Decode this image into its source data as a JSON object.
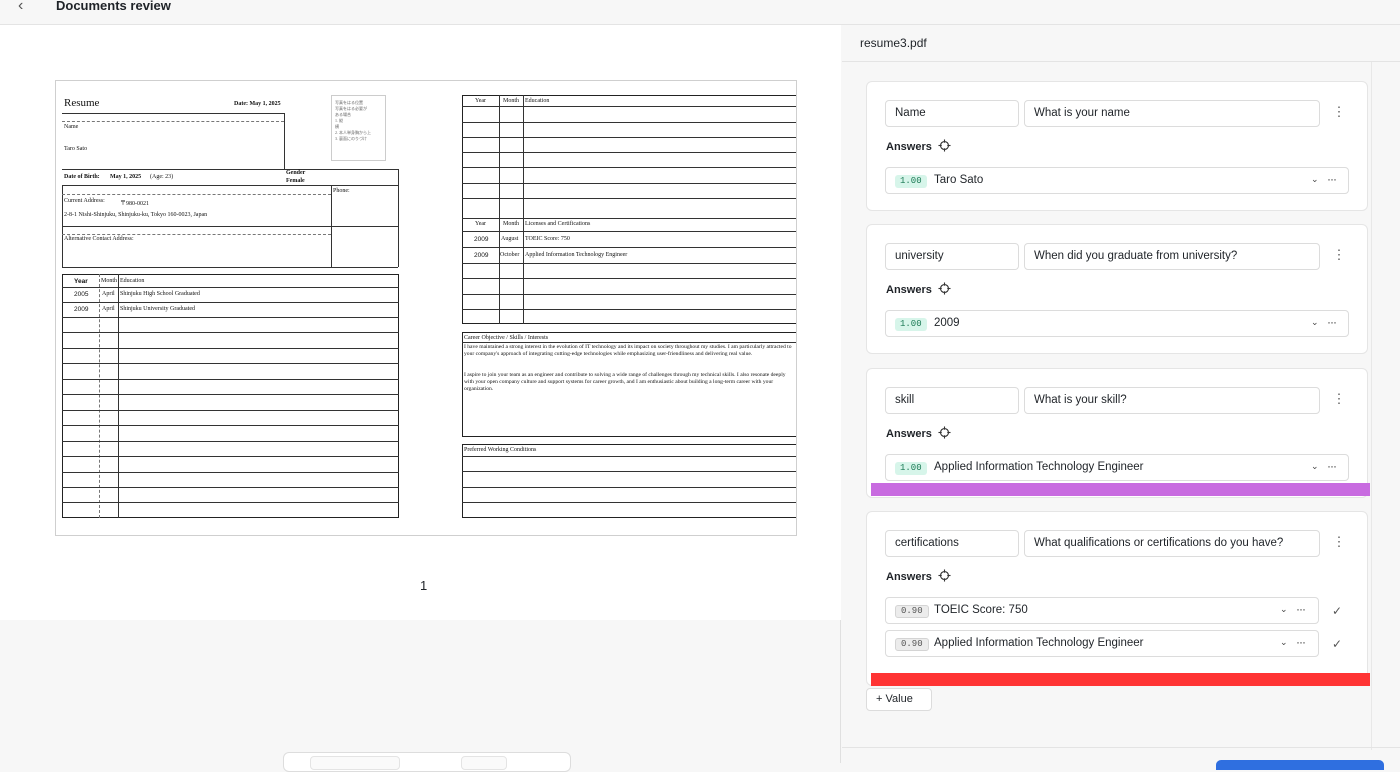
{
  "topbar": {
    "back_icon": "chevron-left-icon",
    "back_glyph": "‹",
    "title": "Documents review"
  },
  "viewer": {
    "page_number": "1",
    "document": {
      "title": "Resume",
      "date": "Date: May 1, 2025",
      "name_label": "Name",
      "name_value": "Taro Sato",
      "dob_label": "Date of Birth:",
      "dob_value": "May 1, 2025",
      "age": "(Age: 23)",
      "gender_label": "Gender",
      "gender_value": "Female",
      "phone_label": "Phone:",
      "address_label": "Current Address:",
      "postal": "〒980-0021",
      "address_value": "2-8-1 Nishi-Shinjuku, Shinjuku-ku, Tokyo 160-0023, Japan",
      "alt_address_label": "Alternative Contact Address:",
      "photo_lines": [
        "写真をはる位置",
        "",
        "写真をはる必要が",
        "ある場合",
        "1. 縦",
        "  横",
        "2. 本人単身胸から上",
        "3. 裏面にのりづけ"
      ],
      "edu_left_headers": [
        "Year",
        "Month",
        "Education"
      ],
      "edu_left_rows": [
        [
          "2005",
          "April",
          "Shinjuku High School Graduated"
        ],
        [
          "2009",
          "April",
          "Shinjuku University Graduated"
        ]
      ],
      "edu_right_headers": [
        "Year",
        "Month",
        "Education"
      ],
      "lic_headers": [
        "Year",
        "Month",
        "Licenses and Certifications"
      ],
      "lic_rows": [
        [
          "2009",
          "August",
          "TOEIC Score: 750"
        ],
        [
          "2009",
          "October",
          "Applied Information Technology Engineer"
        ]
      ],
      "career_title": "Career Objective / Skills / Interests",
      "career_p1": "I have maintained a strong interest in the evolution of IT technology and its impact on society throughout my studies. I am particularly attracted to your company's approach of integrating cutting-edge technologies while emphasizing user-friendliness and delivering real value.",
      "career_p2": "I aspire to join your team as an engineer and contribute to solving a wide range of challenges through my technical skills. I also resonate deeply with your open company culture and support systems for career growth, and I am enthusiastic about building a long-term career with your organization.",
      "preferred_title": "Preferred Working Conditions"
    }
  },
  "panel": {
    "file_name": "resume3.pdf",
    "answers_label": "Answers",
    "add_value_label": "Value",
    "cards": [
      {
        "key": "Name",
        "question": "What is your name",
        "answers": [
          {
            "score": "1.00",
            "level": "high",
            "text": "Taro Sato"
          }
        ]
      },
      {
        "key": "university",
        "question": "When did you graduate from university?",
        "answers": [
          {
            "score": "1.00",
            "level": "high",
            "text": "2009"
          }
        ]
      },
      {
        "key": "skill",
        "question": "What is your skill?",
        "answers": [
          {
            "score": "1.00",
            "level": "high",
            "text": "Applied Information Technology Engineer"
          }
        ]
      },
      {
        "key": "certifications",
        "question": "What qualifications or certifications do you have?",
        "answers": [
          {
            "score": "0.90",
            "level": "mid",
            "text": "TOEIC Score: 750"
          },
          {
            "score": "0.90",
            "level": "mid",
            "text": "Applied Information Technology Engineer"
          }
        ]
      }
    ],
    "colors": {
      "skill_bar": "#c86be0",
      "certifications_bar": "#ff3434",
      "primary": "#2f6fe0"
    }
  }
}
